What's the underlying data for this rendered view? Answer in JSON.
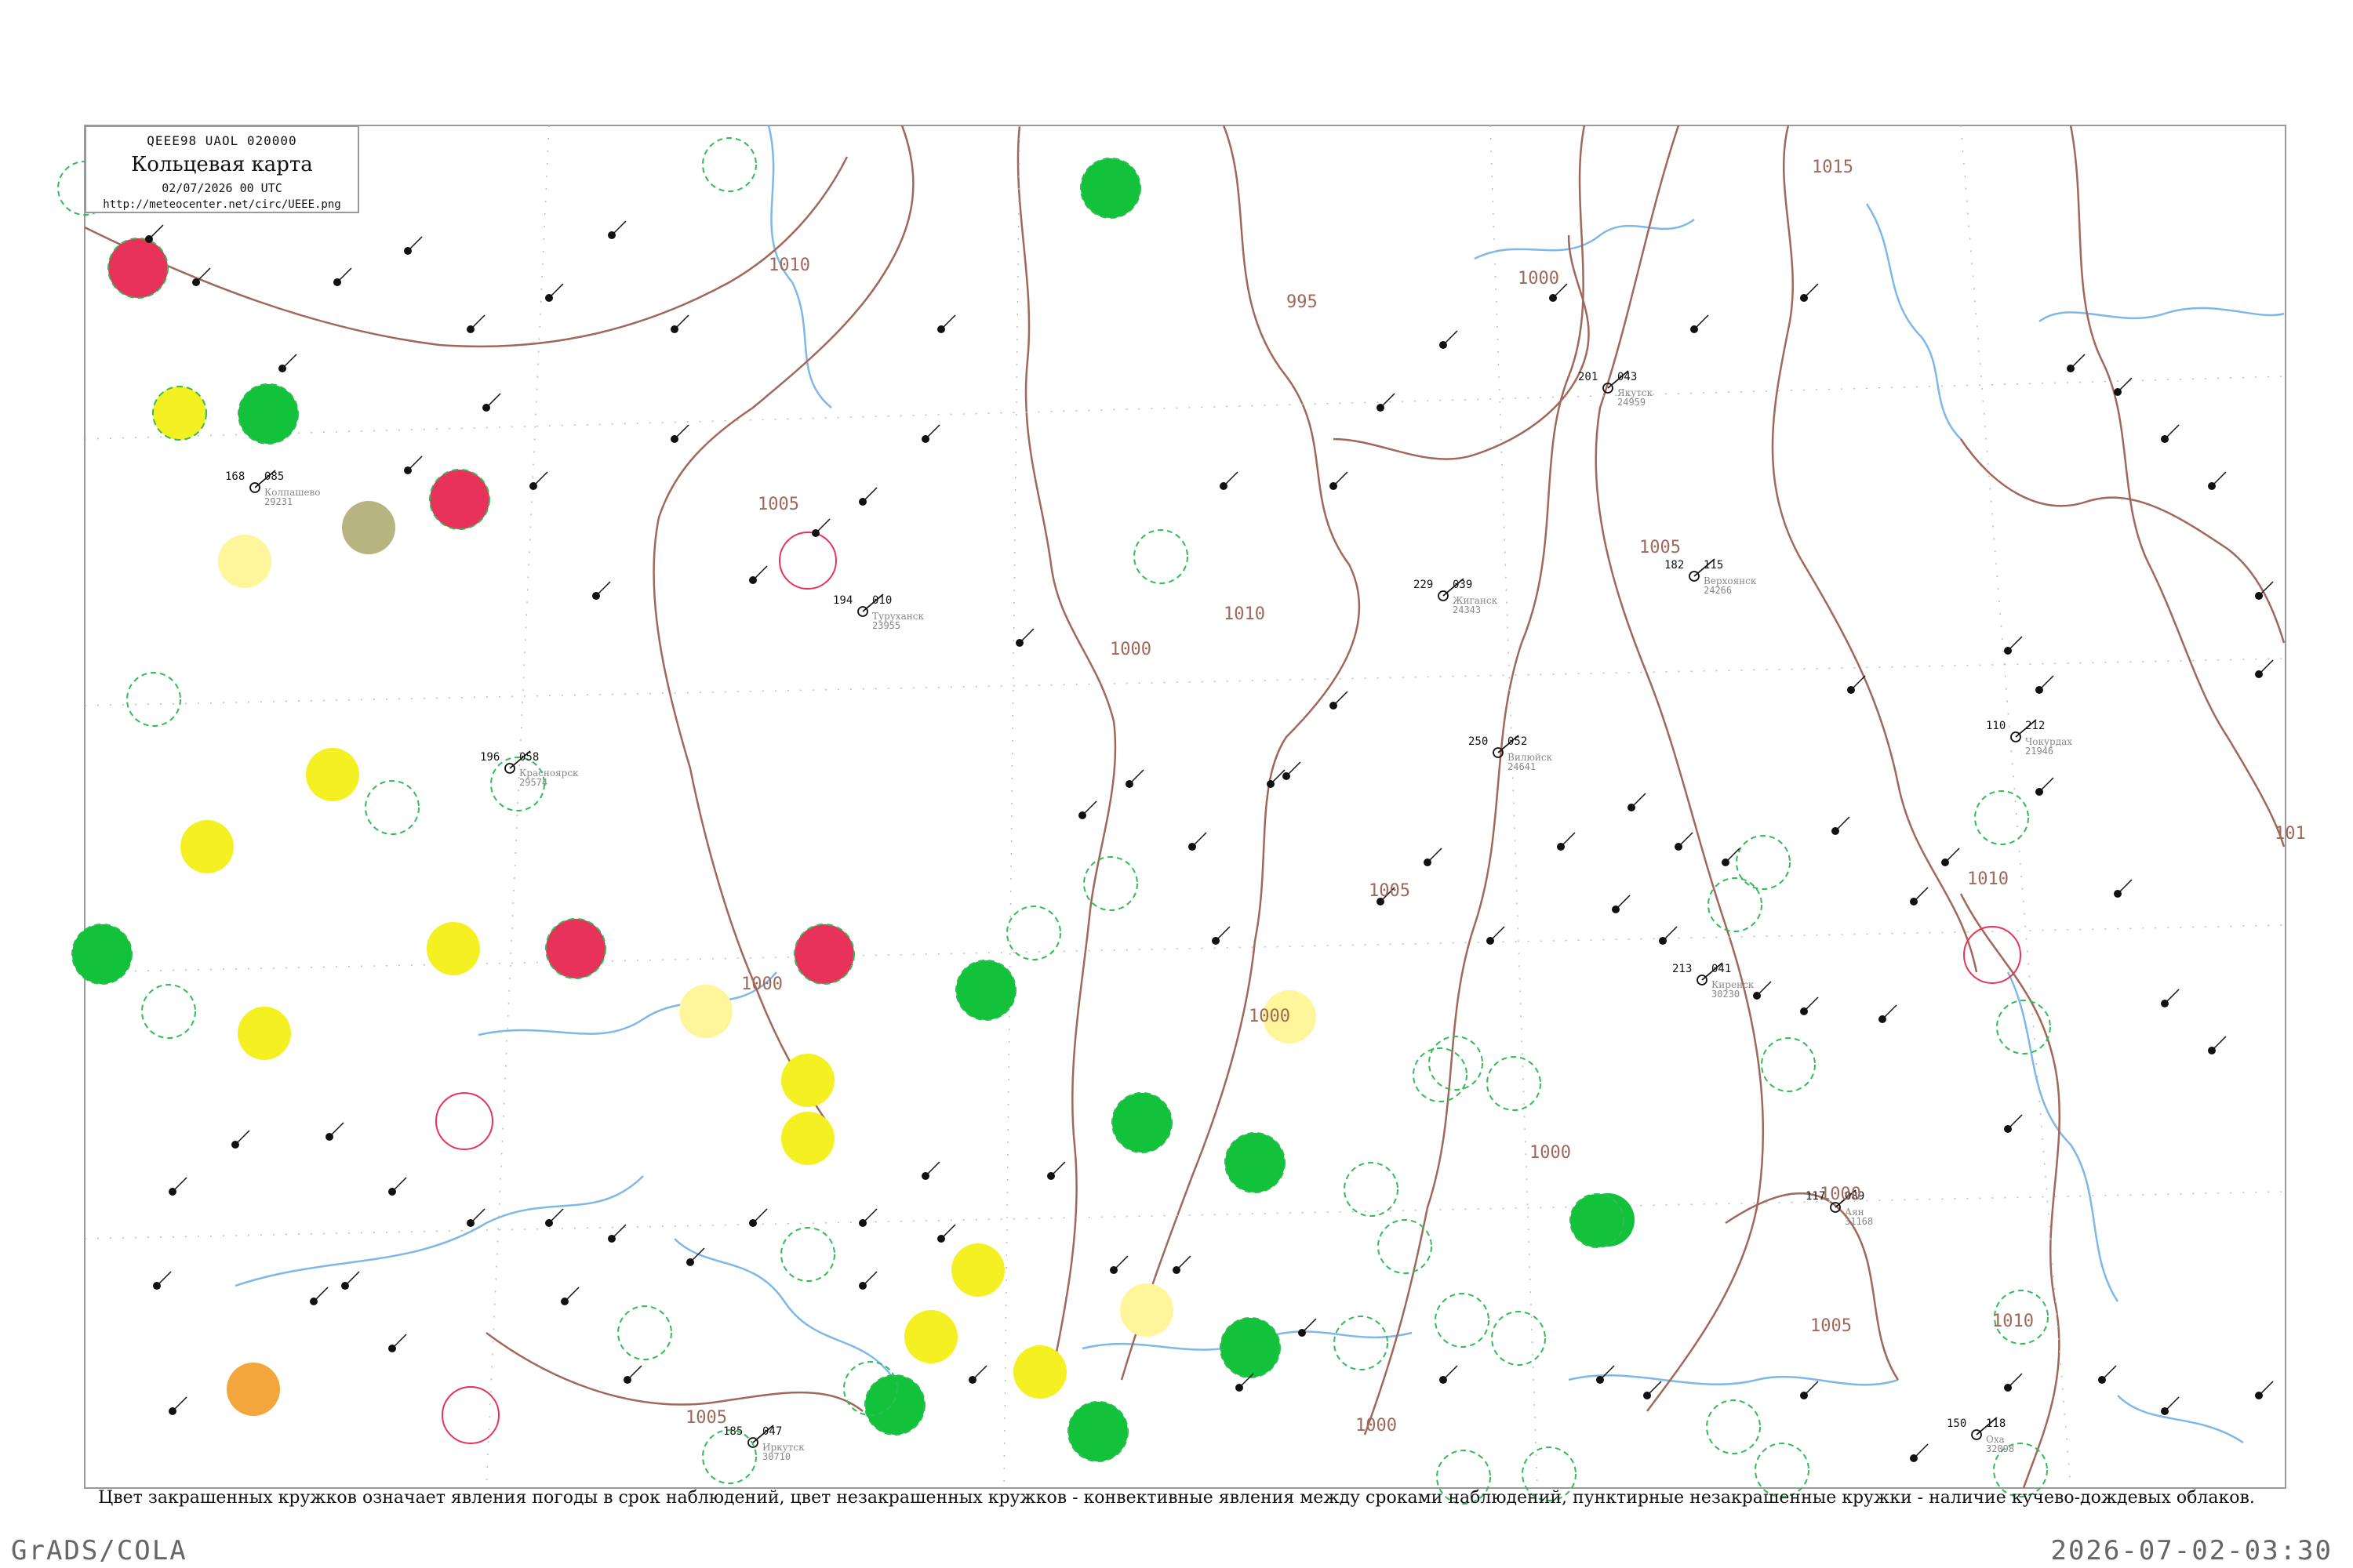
{
  "header": {
    "code": "QEEE98 UAOL 020000",
    "title": "Кольцевая карта",
    "date": "02/07/2026 00 UTC",
    "url": "http://meteocenter.net/circ/UEEE.png"
  },
  "caption": "Цвет закрашенных кружков означает явления погоды в срок наблюдений, цвет незакрашенных кружков - конвективные явления между сроками наблюдений, пунктирные незакрашенные кружки - наличие кучево-дождевых облаков.",
  "footer": {
    "left": "GrADS/COLA",
    "right": "2026-07-02-03:30"
  },
  "colors": {
    "isobar": "#a0685a",
    "river": "#7fb8e8",
    "frame": "#9a9a9a",
    "rain": "#11c23a",
    "shower_ring": "#33bb55",
    "thunder": "#e8325a",
    "fog": "#f5f022",
    "haze": "#fff59a",
    "dust": "#b8b482",
    "smoke": "#f3a63c"
  },
  "isobar_labels": [
    "1010",
    "995",
    "1000",
    "1005",
    "1010",
    "1015",
    "1000",
    "1005",
    "1000",
    "1000",
    "1005",
    "1000",
    "1000",
    "1005",
    "1000",
    "1010",
    "1005",
    "1010",
    "101"
  ],
  "stations": [
    {
      "id": "24266",
      "name": "Верхоянск",
      "t": "182",
      "p": "115"
    },
    {
      "id": "24959",
      "name": "Якутск",
      "t": "201",
      "p": "043"
    },
    {
      "id": "21946",
      "name": "Чокурдах",
      "t": "110",
      "p": "212"
    },
    {
      "id": "31168",
      "name": "Аян",
      "t": "117",
      "p": "089"
    },
    {
      "id": "24641",
      "name": "Вилюйск",
      "t": "250",
      "p": "052"
    },
    {
      "id": "24343",
      "name": "Жиганск",
      "t": "229",
      "p": "039"
    },
    {
      "id": "30230",
      "name": "Киренск",
      "t": "213",
      "p": "041"
    },
    {
      "id": "29231",
      "name": "Колпашево",
      "t": "168",
      "p": "085"
    },
    {
      "id": "23955",
      "name": "Туруханск",
      "t": "194",
      "p": "010"
    },
    {
      "id": "29574",
      "name": "Красноярск",
      "t": "196",
      "p": "058"
    },
    {
      "id": "30710",
      "name": "Иркутск",
      "t": "185",
      "p": "047"
    },
    {
      "id": "32098",
      "name": "Оха",
      "t": "150",
      "p": "118"
    }
  ]
}
